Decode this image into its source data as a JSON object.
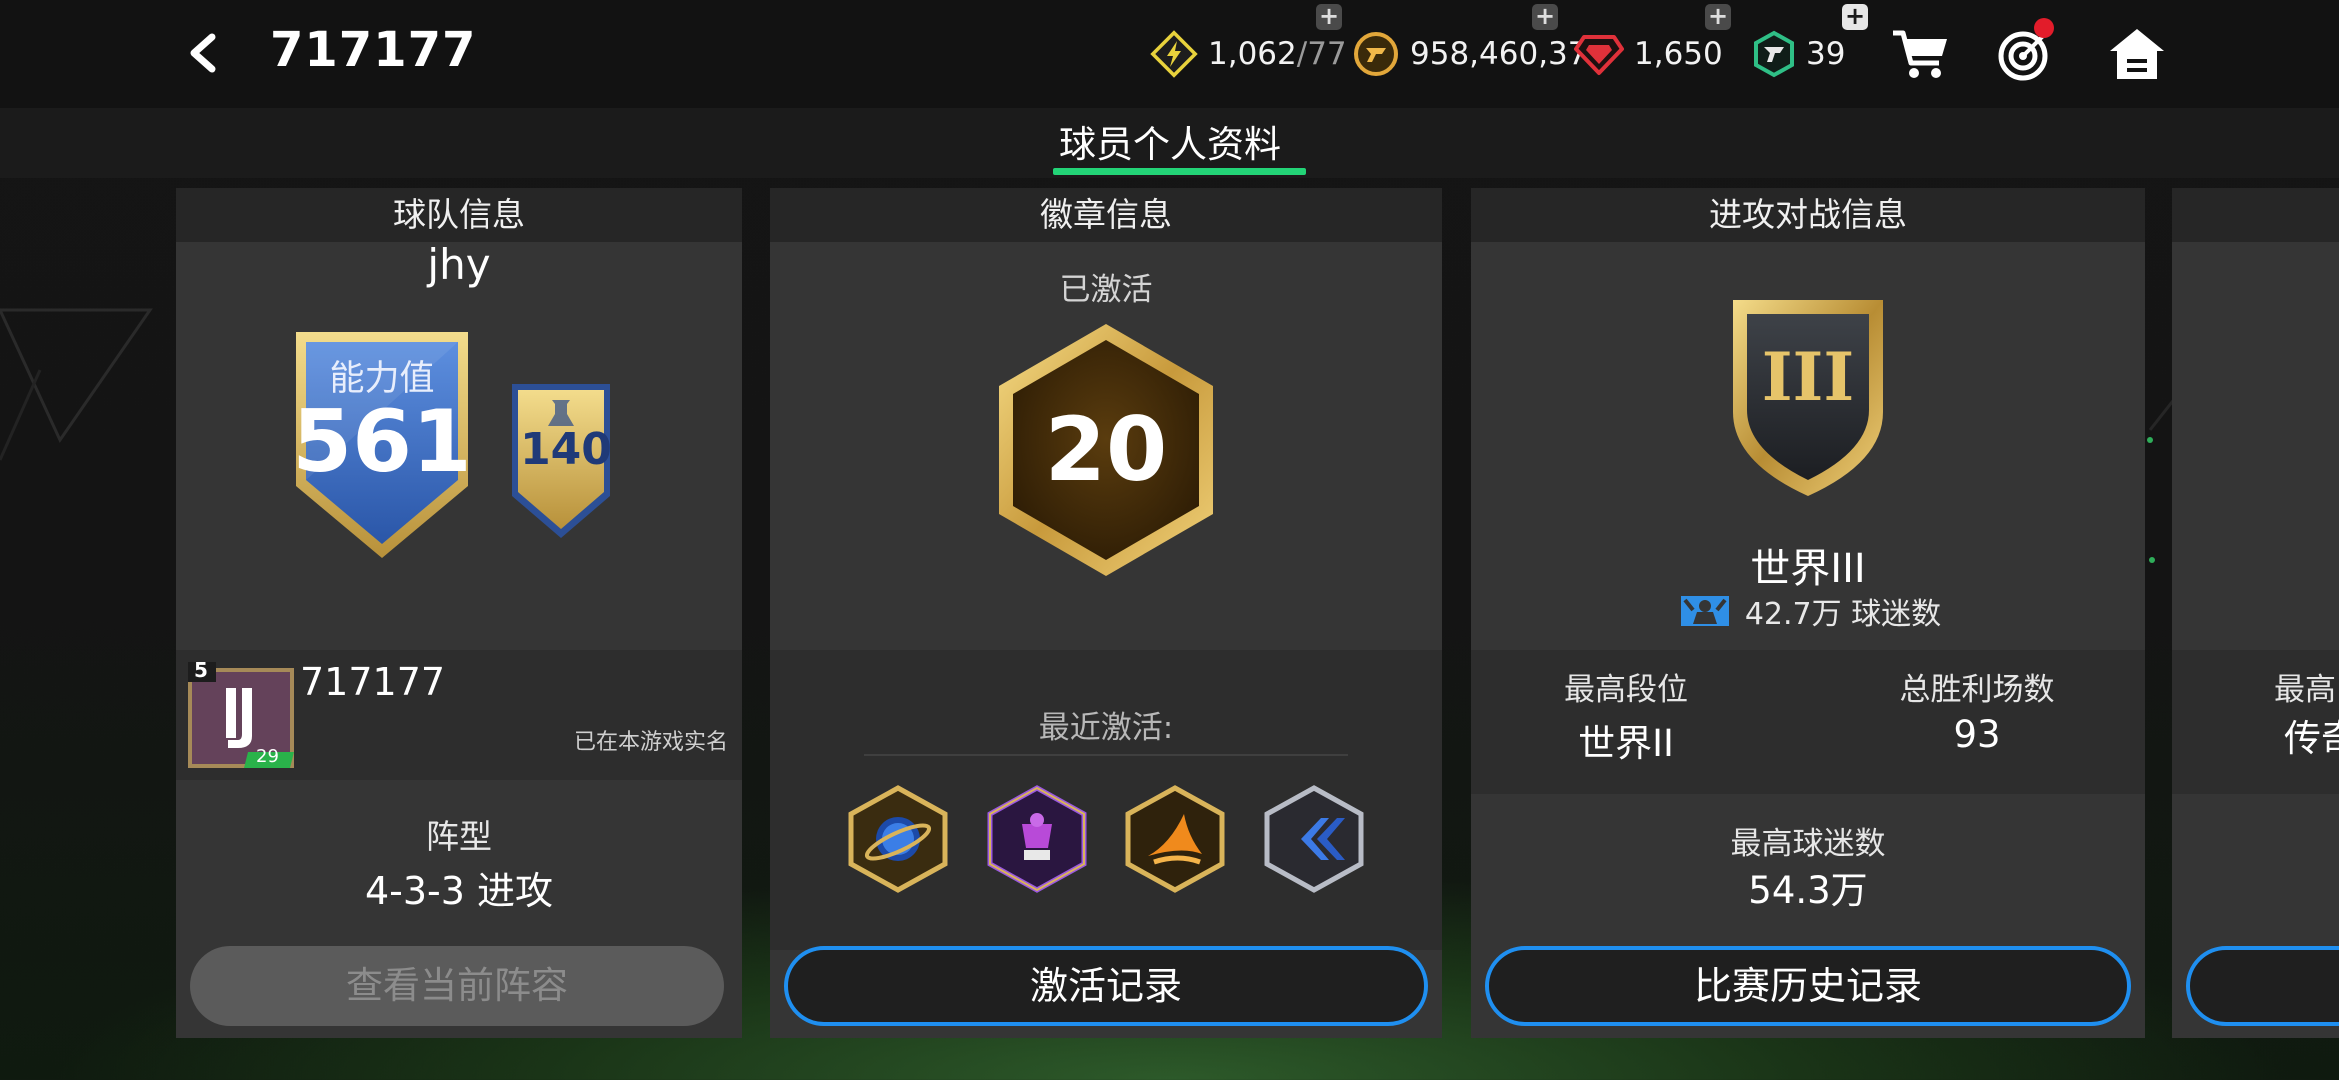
{
  "header": {
    "title": "717177",
    "stamina": {
      "current": "1,062",
      "max": "/77"
    },
    "coins": "958,460,375",
    "gems": "1,650",
    "tokens": "39"
  },
  "tabs": [
    {
      "label": "球员个人资料",
      "active": true
    }
  ],
  "team_panel": {
    "heading": "球队信息",
    "team_name": "jhy",
    "ability_label": "能力值",
    "ability_value": "561",
    "extra_value": "140",
    "avatar_level_top": "5",
    "avatar_level_bottom": "29",
    "username": "717177",
    "verified_text": "已在本游戏实名",
    "formation_label": "阵型",
    "formation_value": "4-3-3 进攻",
    "view_lineup_button": "查看当前阵容"
  },
  "badge_panel": {
    "heading": "徽章信息",
    "activated_label": "已激活",
    "activated_count": "20",
    "recent_label": "最近激活:",
    "recent_badges": [
      {
        "icon": "planet-badge-icon",
        "color": "#2a7ad8"
      },
      {
        "icon": "trophy-cup-badge-icon",
        "color": "#8a2fd0"
      },
      {
        "icon": "wing-flame-badge-icon",
        "color": "#e07a14"
      },
      {
        "icon": "double-chevron-badge-icon",
        "color": "#2e6fd6"
      }
    ],
    "history_button": "激活记录"
  },
  "attack_panel": {
    "heading": "进攻对战信息",
    "rank_roman": "III",
    "rank_name": "世界III",
    "fans_value": "42.7万",
    "fans_label": "球迷数",
    "best_rank_label": "最高段位",
    "best_rank_value": "世界II",
    "total_wins_label": "总胜利场数",
    "total_wins_value": "93",
    "max_fans_label": "最高球迷数",
    "max_fans_value": "54.3万",
    "history_button": "比赛历史记录"
  },
  "partial_panel": {
    "label_fragment": "最高",
    "value_fragment": "传奇"
  },
  "colors": {
    "accent_green": "#23d477",
    "button_blue": "#1f8ff0",
    "gold": "#d9b45a",
    "shield_blue": "#3d6fc4"
  }
}
